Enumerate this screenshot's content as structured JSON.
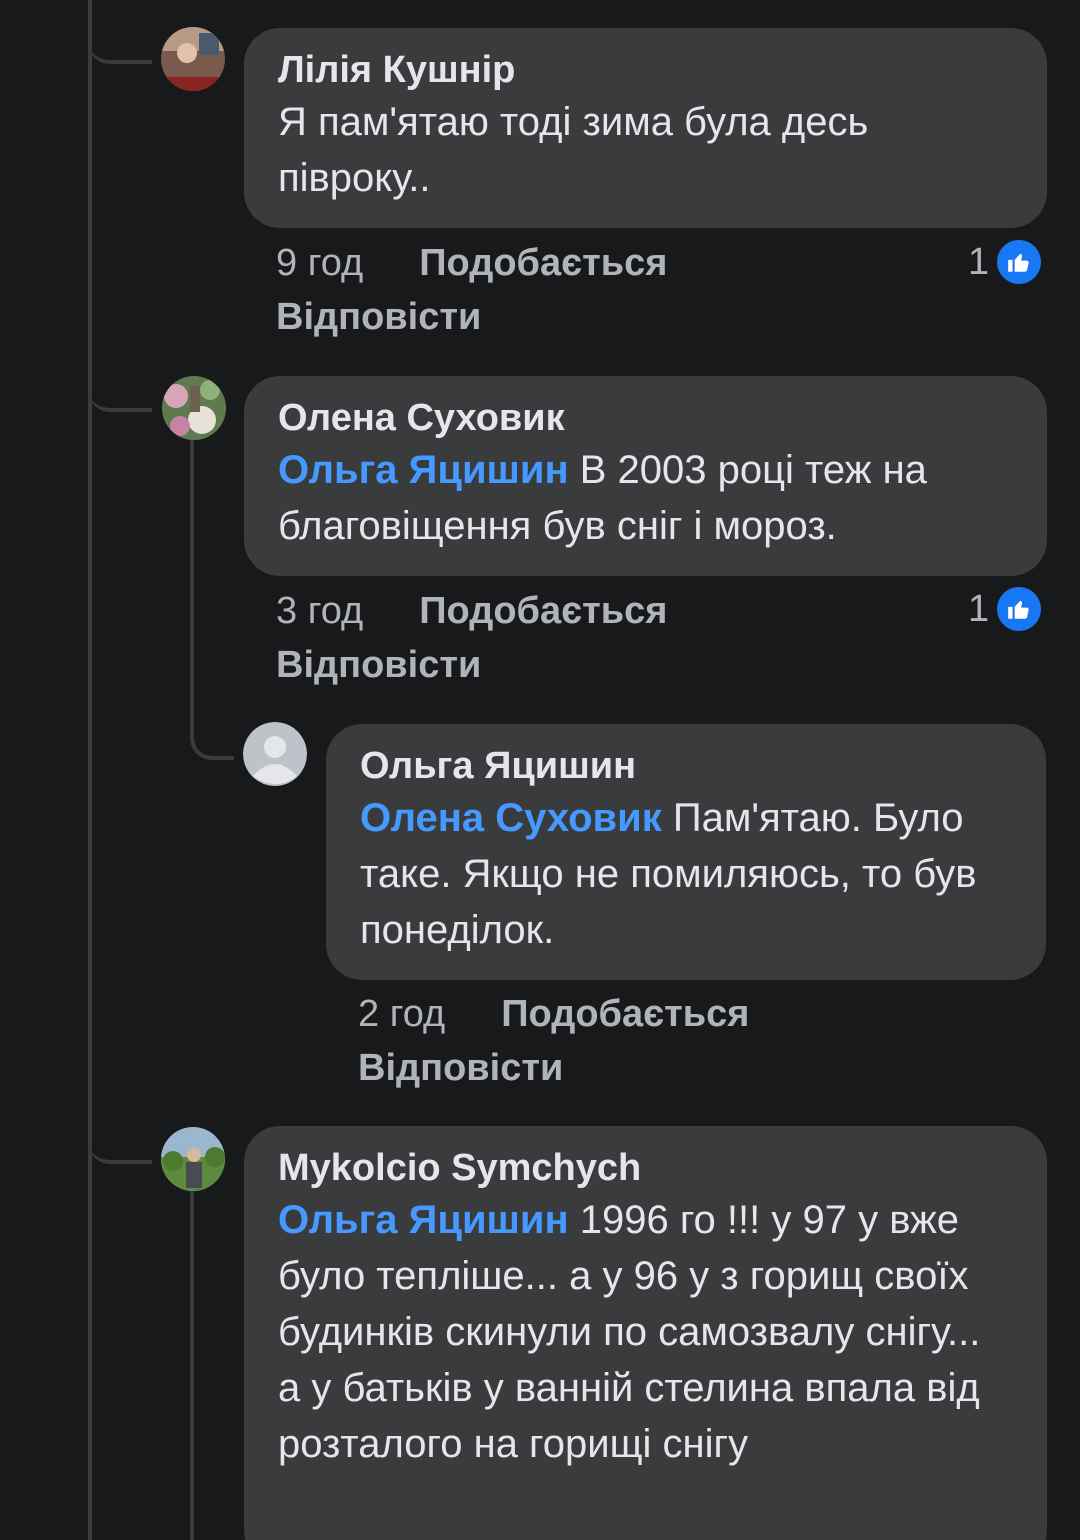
{
  "comments": [
    {
      "author": "Лілія Кушнір",
      "mention": "",
      "text": "Я пам'ятаю тоді зима була десь півроку..",
      "time": "9 год",
      "like_label": "Подобається",
      "reply_label": "Відповісти",
      "reactions": "1"
    },
    {
      "author": "Олена Суховик",
      "mention": "Ольга Яцишин",
      "text": "В 2003 році теж на благовіщення був сніг і мороз.",
      "time": "3 год",
      "like_label": "Подобається",
      "reply_label": "Відповісти",
      "reactions": "1"
    },
    {
      "author": "Ольга Яцишин",
      "mention": "Олена Суховик",
      "text": "Пам'ятаю. Було таке. Якщо не помиляюсь, то був понеділок.",
      "time": "2 год",
      "like_label": "Подобається",
      "reply_label": "Відповісти"
    },
    {
      "author": "Mykolcio Symchych",
      "mention": "Ольга Яцишин",
      "text": "1996 го !!! у 97 у вже було тепліше... а у 96 у з горищ своїх будинків скинули по самозвалу снігу... а у батьків у ванній стелина впала від розталого на горищі снігу"
    }
  ],
  "icons": {
    "like": "thumbs-up-icon",
    "default_avatar": "user-silhouette-icon"
  },
  "colors": {
    "background": "#18191a",
    "bubble": "#3a3b3c",
    "mention": "#4599ff",
    "like_blue": "#1877f2",
    "secondary_text": "#b0b3b8"
  }
}
